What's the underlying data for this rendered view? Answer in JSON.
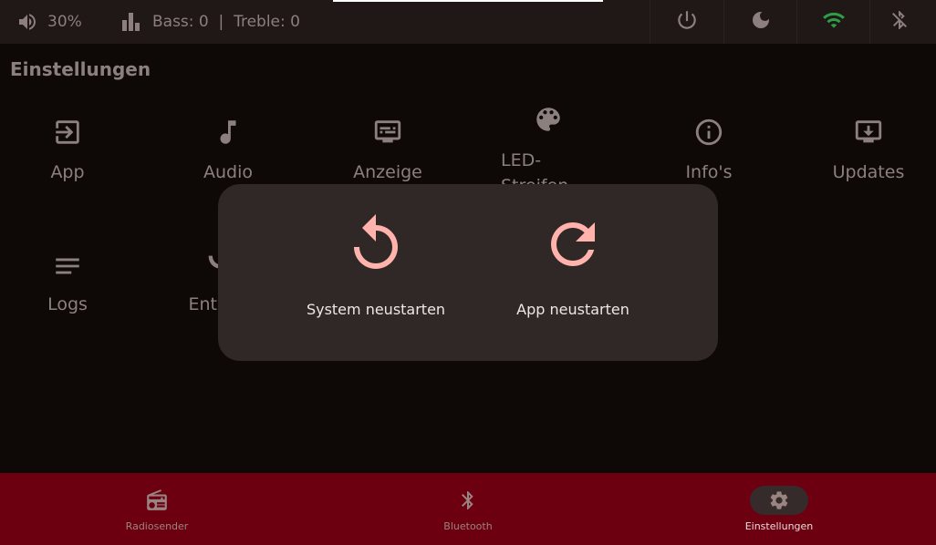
{
  "statusbar": {
    "volume": "30%",
    "equalizer": "Bass: 0  |  Treble: 0",
    "colors": {
      "wifi": "#2e9e46",
      "icon": "#8c7f7d"
    }
  },
  "page": {
    "title": "Einstellungen"
  },
  "settings": {
    "items": [
      {
        "label": "App",
        "icon": "exit-icon"
      },
      {
        "label": "Audio",
        "icon": "music-note-icon"
      },
      {
        "label": "Anzeige",
        "icon": "display-settings-icon"
      },
      {
        "label": "LED-Streifen",
        "icon": "palette-icon"
      },
      {
        "label": "Info's",
        "icon": "info-icon"
      },
      {
        "label": "Updates",
        "icon": "system-update-icon"
      },
      {
        "label": "Logs",
        "icon": "notes-icon"
      },
      {
        "label": "Entw",
        "icon": "developer-icon"
      }
    ]
  },
  "dialog": {
    "system_restart": {
      "label": "System neustarten",
      "icon": "restart-icon"
    },
    "app_restart": {
      "label": "App neustarten",
      "icon": "refresh-icon"
    },
    "icon_color": "#ffb3ac"
  },
  "bottomnav": {
    "items": [
      {
        "label": "Radiosender",
        "icon": "radio-icon",
        "active": false
      },
      {
        "label": "Bluetooth",
        "icon": "bluetooth-icon",
        "active": false
      },
      {
        "label": "Einstellungen",
        "icon": "gear-icon",
        "active": true
      }
    ],
    "background": "#6c0011"
  }
}
